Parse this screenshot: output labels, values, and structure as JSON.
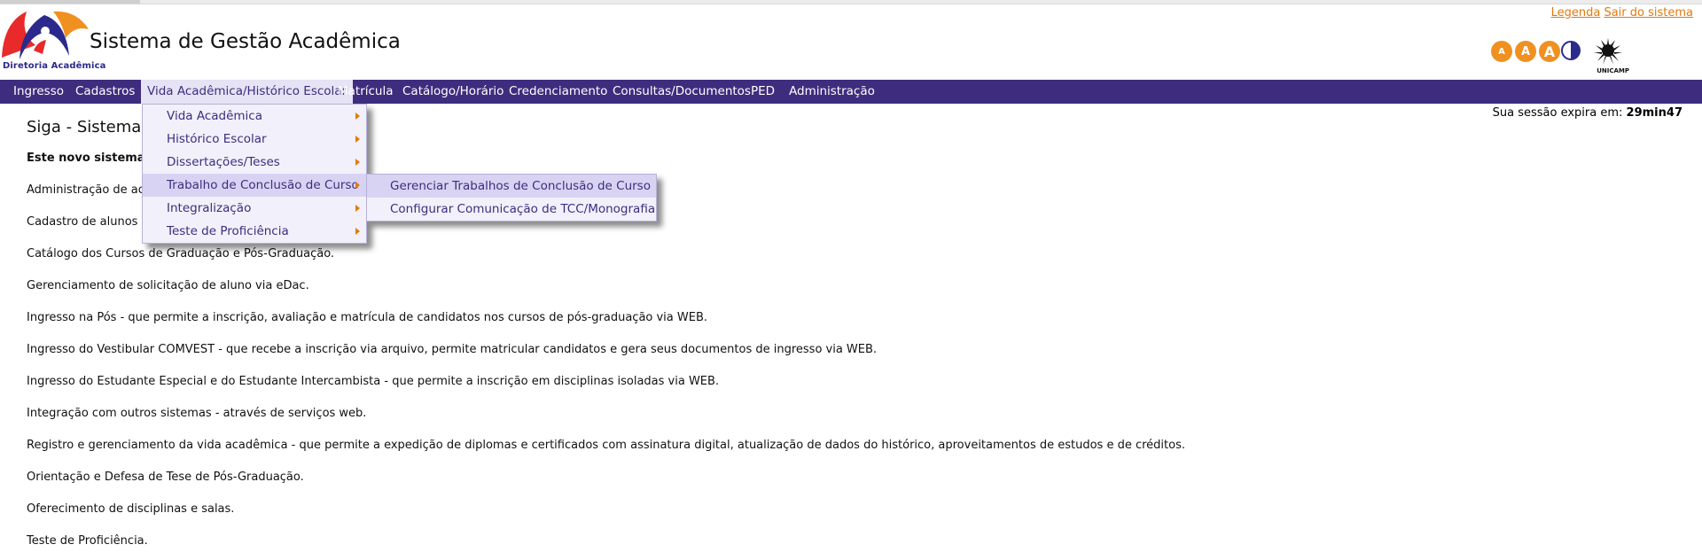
{
  "header": {
    "org_name": "Diretoria Acadêmica",
    "title": "Sistema de Gestão Acadêmica",
    "links": {
      "legend": "Legenda",
      "logout": "Sair do sistema"
    },
    "accessibility": [
      "A",
      "A",
      "A"
    ],
    "unicamp_label": "UNICAMP",
    "colors": {
      "brand": "#3e2d7e",
      "accent": "#f09020",
      "logo_red": "#e82a2a",
      "logo_blue": "#2b2a8c"
    }
  },
  "menu": {
    "items": [
      "Ingresso",
      "Cadastros",
      "Vida Acadêmica/Histórico Escolar",
      "Matrícula",
      "Catálogo/Horário",
      "Credenciamento",
      "Consultas/Documentos",
      "PED",
      "Administração"
    ],
    "active_index": 2
  },
  "dropdown": {
    "items": [
      "Vida Acadêmica",
      "Histórico Escolar",
      "Dissertações/Teses",
      "Trabalho de Conclusão de Curso",
      "Integralização",
      "Teste de Proficiência"
    ],
    "highlighted_index": 3
  },
  "submenu": {
    "items": [
      "Gerenciar Trabalhos de Conclusão de Curso",
      "Configurar Comunicação de TCC/Monografia"
    ],
    "highlighted_index": 0
  },
  "session": {
    "label": "Sua sessão expira em:",
    "time": "29min47"
  },
  "content": {
    "heading_visible": "Siga - Sistema",
    "intro_visible": "Este novo sistema",
    "lines": [
      "Administração de ace",
      "Cadastro de alunos -",
      "Catálogo dos Cursos de Graduação e Pós-Graduação.",
      "Gerenciamento de solicitação de aluno via eDac.",
      "Ingresso na Pós - que permite a inscrição, avaliação e matrícula de candidatos nos cursos de pós-graduação via WEB.",
      "Ingresso do Vestibular COMVEST - que recebe a inscrição via arquivo, permite matricular candidatos e gera seus documentos de ingresso via WEB.",
      "Ingresso do Estudante Especial e do Estudante Intercambista - que permite a inscrição em disciplinas isoladas via WEB.",
      "Integração com outros sistemas - através de serviços web.",
      "Registro e gerenciamento da vida acadêmica - que permite a expedição de diplomas e certificados com assinatura digital, atualização de dados do histórico, aproveitamentos de estudos e de créditos.",
      "Orientação e Defesa de Tese de Pós-Graduação.",
      "Oferecimento de disciplinas e salas.",
      "Teste de Proficiência."
    ]
  }
}
